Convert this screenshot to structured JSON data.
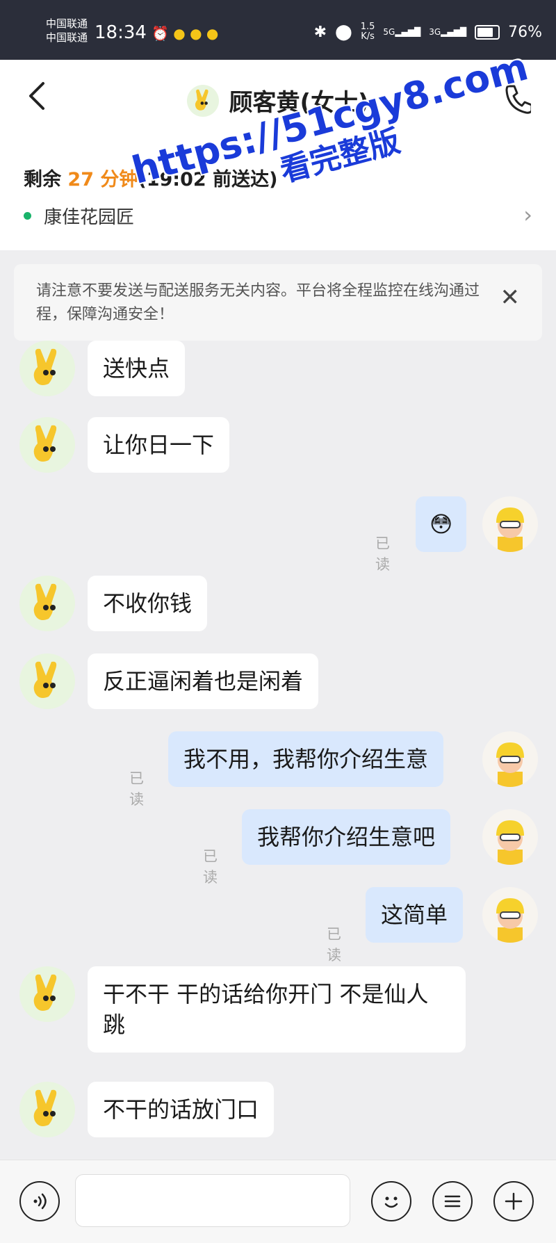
{
  "status_bar": {
    "carrier1": "中国联通",
    "carrier2": "中国联通",
    "time": "18:34",
    "net_speed": "1.5",
    "net_unit": "K/s",
    "signal1": "5G",
    "signal2": "3G",
    "battery": "76%"
  },
  "header": {
    "back_icon": "chevron-left-icon",
    "title": "顾客黄(女士)",
    "call_icon": "phone-icon"
  },
  "delivery": {
    "remaining_prefix": "剩余 ",
    "minutes": "27 分钟",
    "deadline": "(19:02 前送达)",
    "address": "康佳花园匠"
  },
  "watermark": {
    "url": "https://51cgy8.com",
    "text": "看完整版"
  },
  "notice": {
    "text": "请注意不要发送与配送服务无关内容。平台将全程监控在线沟通过程，保障沟通安全！"
  },
  "messages": [
    {
      "side": "in",
      "text": "送快点"
    },
    {
      "side": "in",
      "text": "让你日一下"
    },
    {
      "side": "out",
      "text": "😳",
      "read": "已读"
    },
    {
      "side": "in",
      "text": "不收你钱"
    },
    {
      "side": "in",
      "text": "反正逼闲着也是闲着"
    },
    {
      "side": "out",
      "text": "我不用，我帮你介绍生意",
      "read": "已读"
    },
    {
      "side": "out",
      "text": "我帮你介绍生意吧",
      "read": "已读"
    },
    {
      "side": "out",
      "text": "这简单",
      "read": "已读"
    },
    {
      "side": "in",
      "text": "干不干 干的话给你开门 不是仙人跳"
    },
    {
      "side": "in",
      "text": "不干的话放门口"
    }
  ],
  "input_bar": {
    "voice_icon": "voice-icon",
    "placeholder": "",
    "emoji_icon": "emoji-icon",
    "menu_icon": "list-icon",
    "plus_icon": "plus-icon"
  },
  "colors": {
    "accent_orange": "#f08a1a",
    "out_bubble": "#d9e8fd",
    "status_dot": "#19b36a",
    "watermark": "#1a3bd9"
  }
}
